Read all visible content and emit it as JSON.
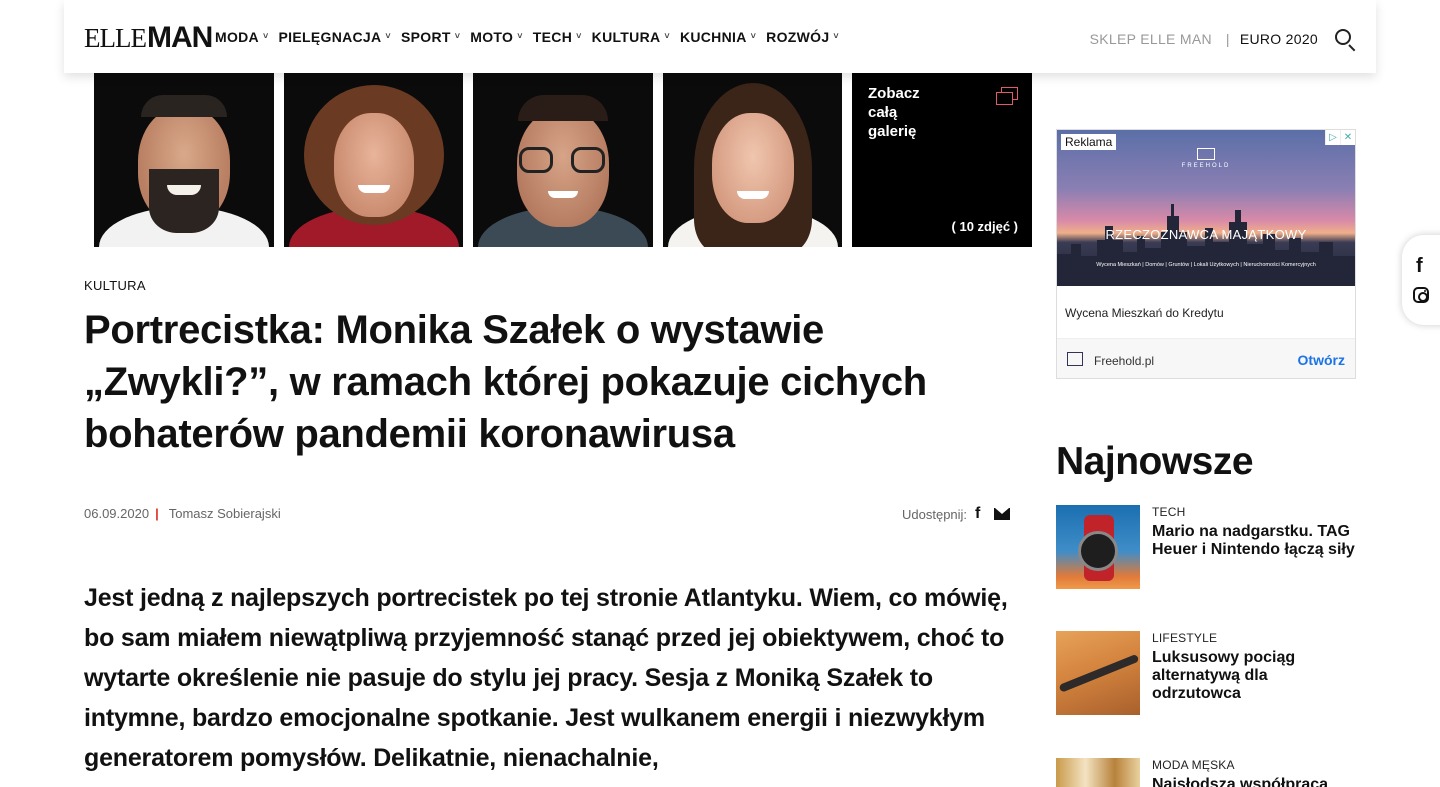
{
  "header": {
    "logo_elle": "ELLE",
    "logo_man": "MAN",
    "nav": [
      {
        "label": "MODA"
      },
      {
        "label": "PIELĘGNACJA"
      },
      {
        "label": "SPORT"
      },
      {
        "label": "MOTO"
      },
      {
        "label": "TECH"
      },
      {
        "label": "KULTURA"
      },
      {
        "label": "KUCHNIA"
      },
      {
        "label": "ROZWÓJ"
      }
    ],
    "shop_link": "SKLEP ELLE MAN",
    "separator": "|",
    "euro_link": "EURO 2020",
    "search_icon": "search-icon"
  },
  "gallery": {
    "more_label": "Zobacz całą galerię",
    "count_label": "( 10 zdjęć )"
  },
  "article": {
    "category": "KULTURA",
    "title": "Portrecistka: Monika Szałek o wystawie „Zwykli?”, w ramach której pokazuje cichych bohaterów pandemii koronawirusa",
    "date": "06.09.2020",
    "separator": "|",
    "author": "Tomasz Sobierajski",
    "share_label": "Udostępnij:",
    "share_fb": "f",
    "lead": "Jest jedną z najlepszych portrecistek po tej stronie Atlantyku. Wiem, co mówię, bo sam miałem niewątpliwą przyjemność stanąć przed jej obiektywem, choć to wytarte określenie nie pasuje do stylu jej pracy. Sesja z Moniką Szałek to intymne, bardzo emocjonalne spotkanie. Jest wulkanem energii i niezwykłym generatorem pomysłów. Delikatnie, nienachalnie,"
  },
  "ad": {
    "tag": "Reklama",
    "close_a": "▷",
    "close_b": "✕",
    "brand": "FREEHOLD",
    "headline": "RZECZOZNAWCA MAJĄTKOWY",
    "subline": "Wycena Mieszkań | Domów | Gruntów | Lokali Użytkowych | Nieruchomości Komercyjnych",
    "description": "Wycena Mieszkań do Kredytu",
    "domain": "Freehold.pl",
    "cta": "Otwórz"
  },
  "latest": {
    "title": "Najnowsze",
    "items": [
      {
        "category": "TECH",
        "headline": "Mario na nadgarstku. TAG Heuer i Nintendo łączą siły"
      },
      {
        "category": "LIFESTYLE",
        "headline": "Luksusowy pociąg alternatywą dla odrzutowca"
      },
      {
        "category": "MODA MĘSKA",
        "headline": "Najsłodsza współpraca"
      }
    ]
  },
  "social": {
    "fb": "f"
  }
}
